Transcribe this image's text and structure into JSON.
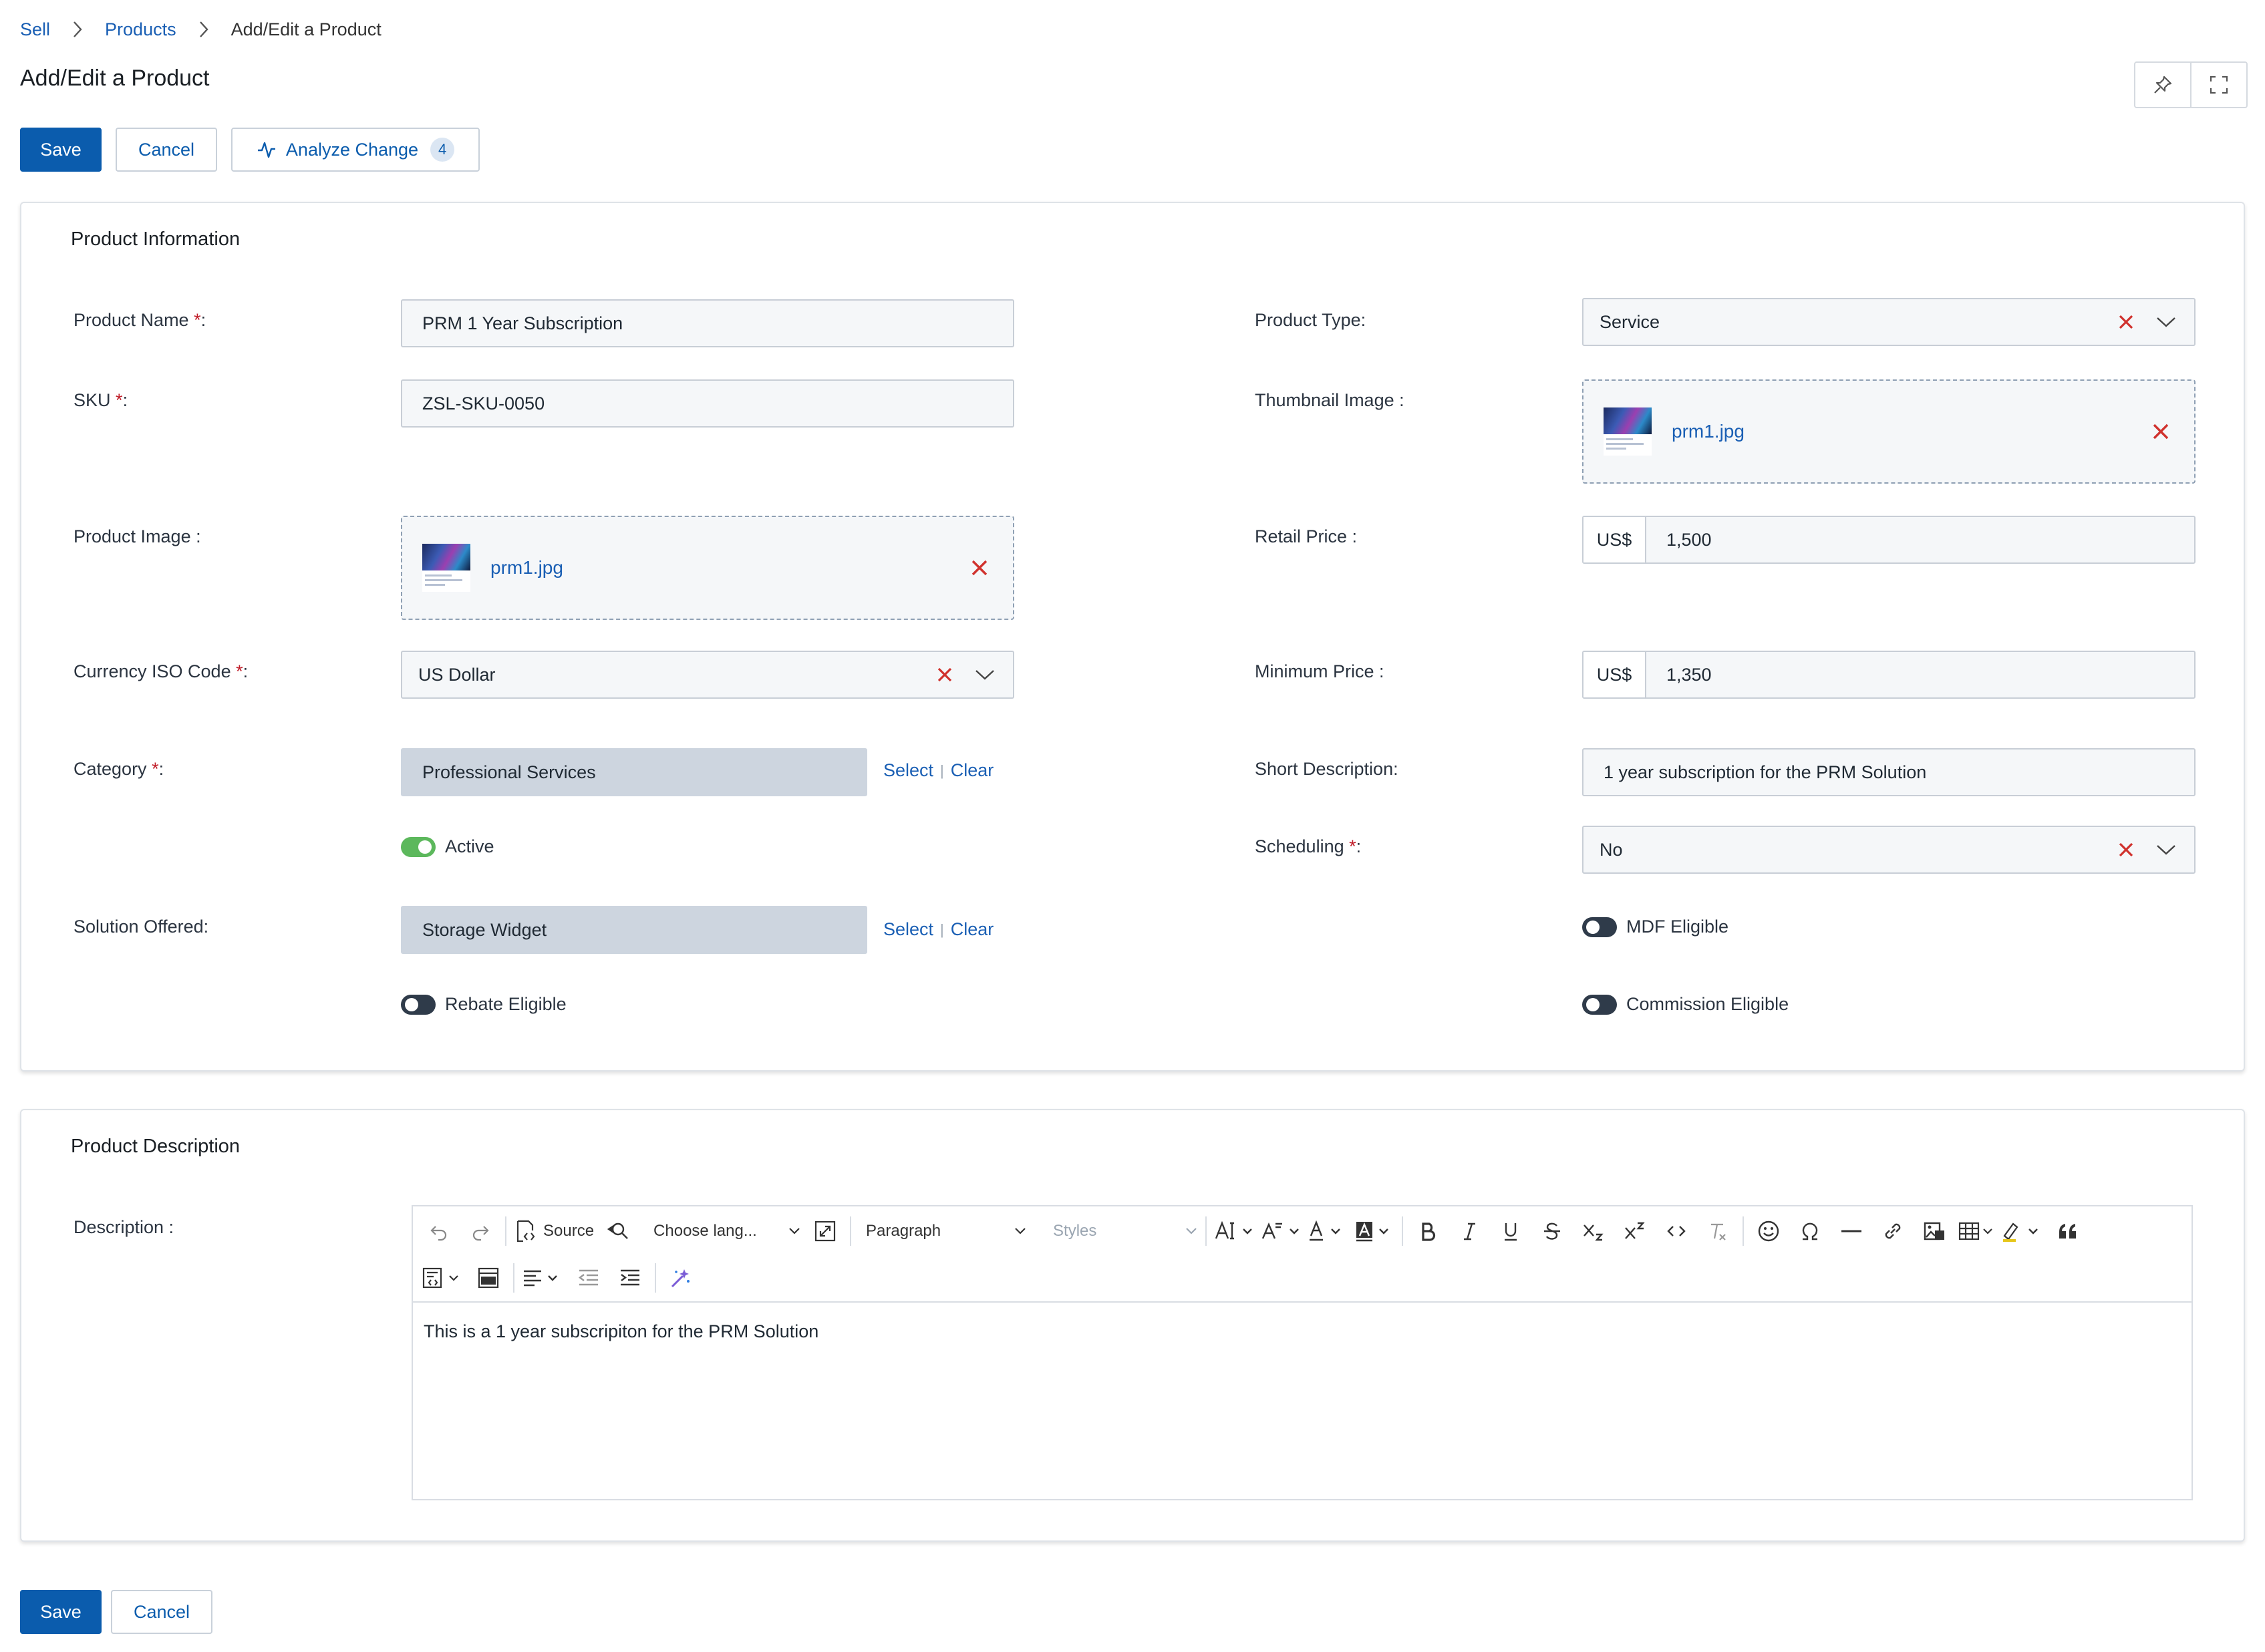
{
  "breadcrumb": {
    "items": [
      "Sell",
      "Products",
      "Add/Edit a Product"
    ]
  },
  "page": {
    "title": "Add/Edit a Product"
  },
  "header_icons": [
    "pin-icon",
    "expand-icon"
  ],
  "actions": {
    "save_label": "Save",
    "cancel_label": "Cancel",
    "analyze_label": "Analyze Change",
    "analyze_count": "4"
  },
  "product_information": {
    "title": "Product Information",
    "product_name": {
      "label": "Product Name",
      "value": "PRM 1 Year Subscription"
    },
    "sku": {
      "label": "SKU",
      "value": "ZSL-SKU-0050"
    },
    "product_image": {
      "label": "Product Image :",
      "file": "prm1.jpg"
    },
    "currency": {
      "label": "Currency ISO Code",
      "value": "US Dollar"
    },
    "category": {
      "label": "Category",
      "value": "Professional Services",
      "select": "Select",
      "clear": "Clear"
    },
    "active": {
      "label": "Active",
      "on": true
    },
    "solution_offered": {
      "label": "Solution Offered:",
      "value": "Storage Widget",
      "select": "Select",
      "clear": "Clear"
    },
    "rebate_eligible": {
      "label": "Rebate Eligible",
      "on": false
    },
    "product_type": {
      "label": "Product Type:",
      "value": "Service"
    },
    "thumbnail_image": {
      "label": "Thumbnail Image :",
      "file": "prm1.jpg"
    },
    "retail_price": {
      "label": "Retail Price :",
      "prefix": "US$",
      "value": "1,500"
    },
    "minimum_price": {
      "label": "Minimum Price :",
      "prefix": "US$",
      "value": "1,350"
    },
    "short_description": {
      "label": "Short Description:",
      "value": "1 year subscription for the PRM Solution"
    },
    "scheduling": {
      "label": "Scheduling",
      "value": "No"
    },
    "mdf_eligible": {
      "label": "MDF Eligible",
      "on": false
    },
    "commission_eligible": {
      "label": "Commission Eligible",
      "on": false
    },
    "required_marker": "*",
    "label_suffix": ":"
  },
  "product_description": {
    "title": "Product Description",
    "label": "Description :",
    "toolbar": {
      "source": "Source",
      "language": "Choose lang...",
      "paragraph": "Paragraph",
      "styles": "Styles"
    },
    "content": "This is a 1 year subscripiton for the PRM Solution"
  },
  "colors": {
    "primary": "#0b5cad",
    "link": "#1a5fb4",
    "danger": "#d0312d",
    "toggle_on": "#5cb85c",
    "toggle_off": "#2f3b4a"
  }
}
